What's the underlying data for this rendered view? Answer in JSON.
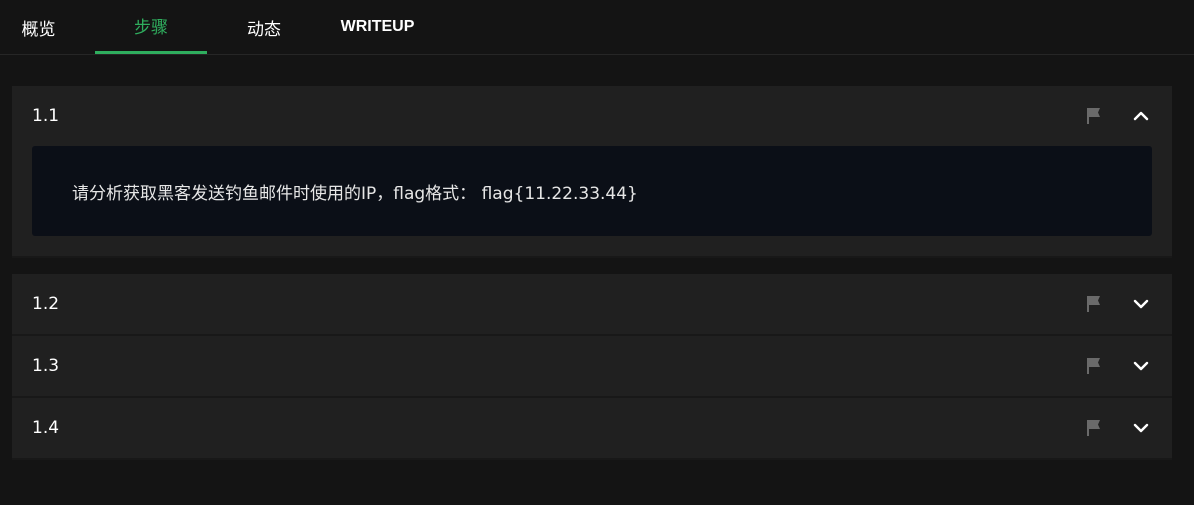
{
  "tabs": [
    {
      "label": "概览"
    },
    {
      "label": "步骤"
    },
    {
      "label": "动态"
    },
    {
      "label": "WRITEUP"
    }
  ],
  "active_tab": "步骤",
  "accent_color": "#2fae5e",
  "steps": [
    {
      "number": "1.1",
      "expanded": true,
      "content": "请分析获取黑客发送钓鱼邮件时使用的IP，flag格式： flag{11.22.33.44}"
    },
    {
      "number": "1.2",
      "expanded": false
    },
    {
      "number": "1.3",
      "expanded": false
    },
    {
      "number": "1.4",
      "expanded": false
    }
  ],
  "icons": {
    "flag": "flag-icon",
    "collapse": "chevron-up-icon",
    "expand": "chevron-down-icon"
  }
}
